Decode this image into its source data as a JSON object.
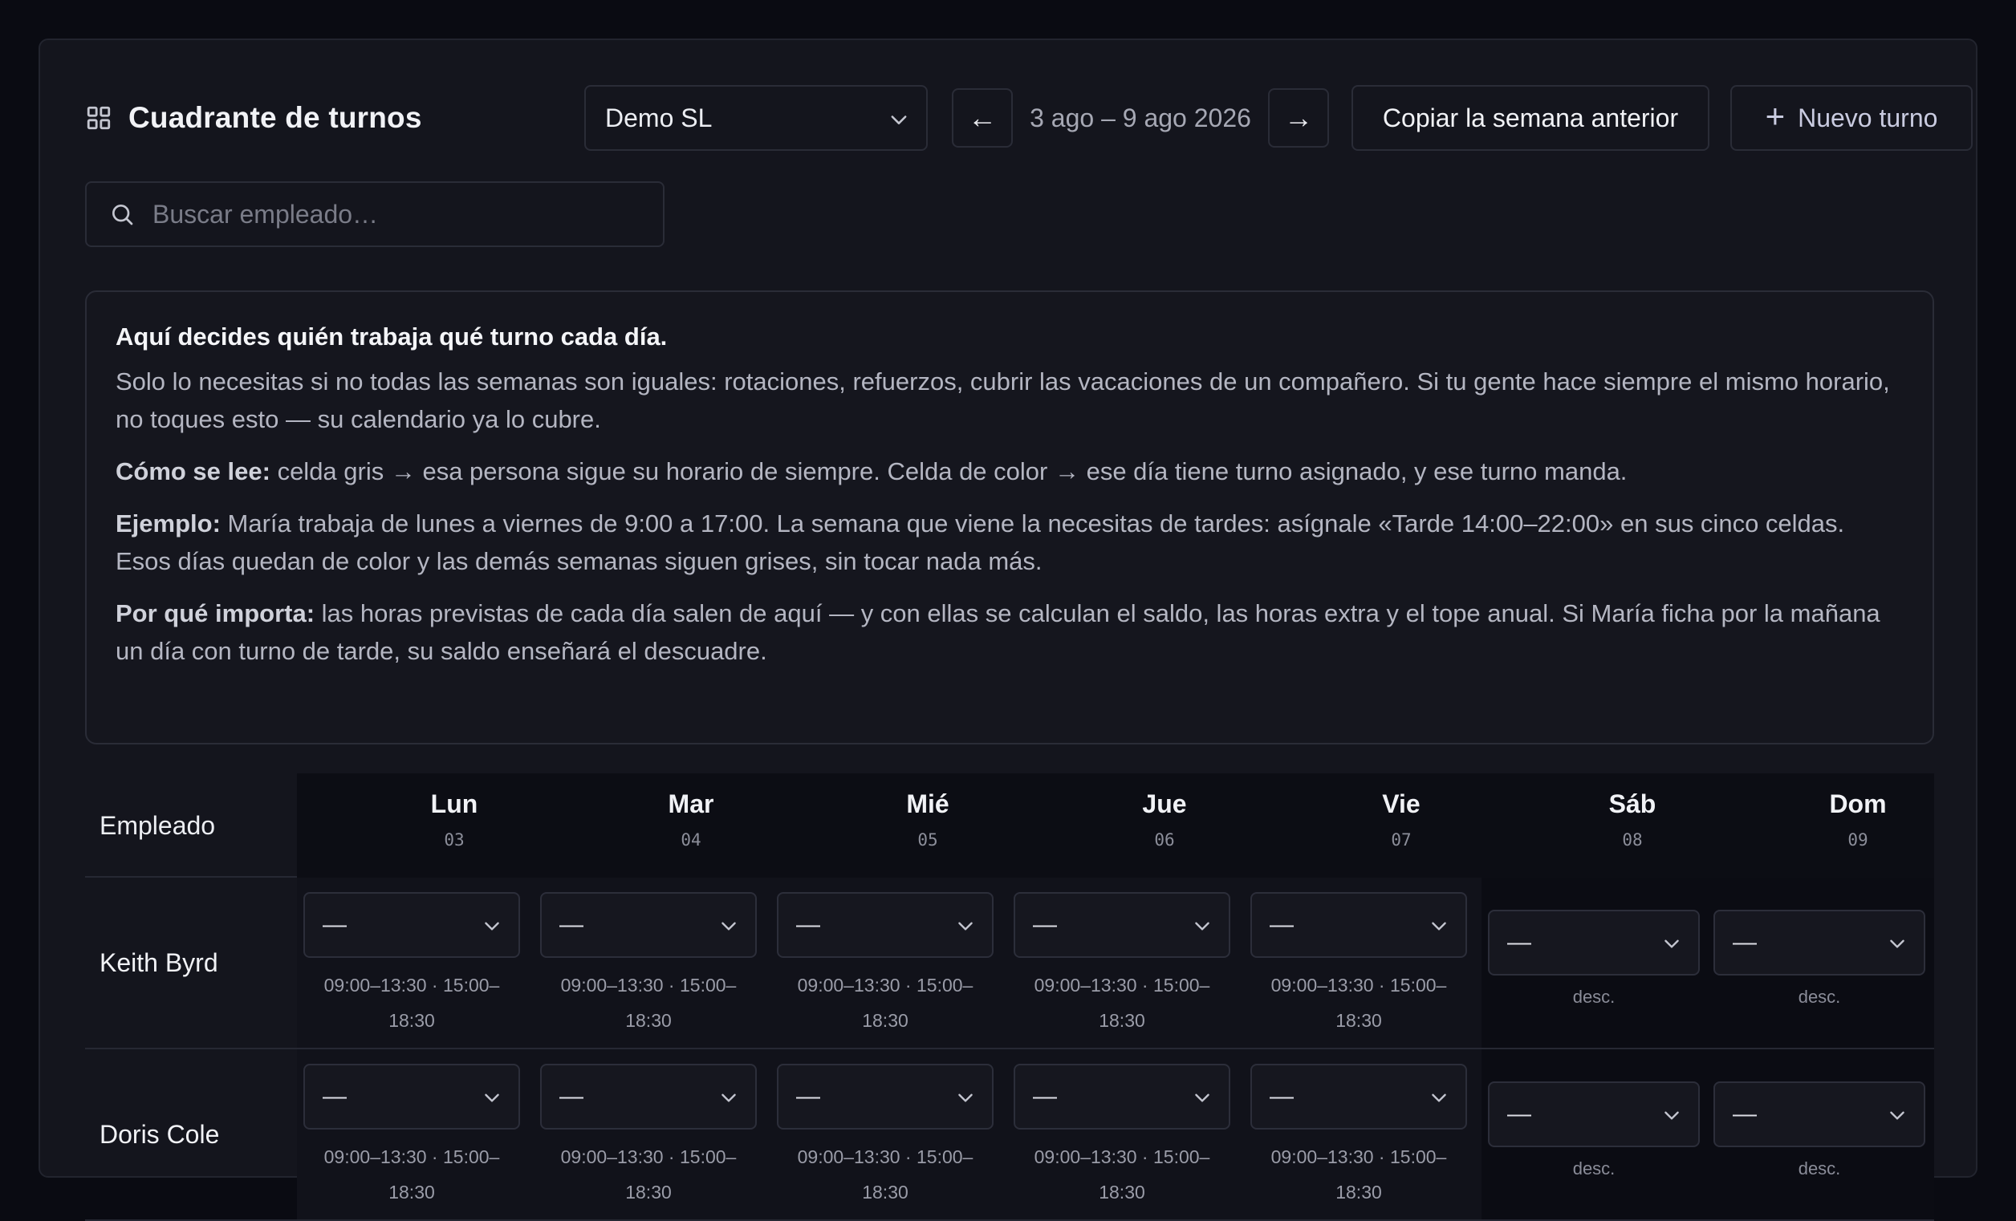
{
  "header": {
    "title": "Cuadrante de turnos",
    "company": "Demo SL",
    "prev_label": "←",
    "next_label": "→",
    "week_range": "3 ago – 9 ago 2026",
    "copy_week_label": "Copiar la semana anterior",
    "new_shift_label": "Nuevo turno"
  },
  "search": {
    "placeholder": "Buscar empleado…"
  },
  "info": {
    "heading": "Aquí decides quién trabaja qué turno cada día.",
    "p1": "Solo lo necesitas si no todas las semanas son iguales: rotaciones, refuerzos, cubrir las vacaciones de un compañero. Si tu gente hace siempre el mismo horario, no toques esto — su calendario ya lo cubre.",
    "p2_label": "Cómo se lee:",
    "p2": " celda gris → esa persona sigue su horario de siempre. Celda de color → ese día tiene turno asignado, y ese turno manda.",
    "p3_label": "Ejemplo:",
    "p3": " María trabaja de lunes a viernes de 9:00 a 17:00. La semana que viene la necesitas de tardes: asígnale «Tarde 14:00–22:00» en sus cinco celdas. Esos días quedan de color y las demás semanas siguen grises, sin tocar nada más.",
    "p4_label": "Por qué importa:",
    "p4": " las horas previstas de cada día salen de aquí — y con ellas se calculan el saldo, las horas extra y el tope anual. Si María ficha por la mañana un día con turno de tarde, su saldo enseñará el descuadre."
  },
  "table": {
    "employee_header": "Empleado",
    "days": [
      {
        "name": "Lun",
        "date": "03"
      },
      {
        "name": "Mar",
        "date": "04"
      },
      {
        "name": "Mié",
        "date": "05"
      },
      {
        "name": "Jue",
        "date": "06"
      },
      {
        "name": "Vie",
        "date": "07"
      },
      {
        "name": "Sáb",
        "date": "08"
      },
      {
        "name": "Dom",
        "date": "09"
      }
    ],
    "select_value": "—",
    "weekday_hours_line1": "09:00–13:30 · 15:00–",
    "weekday_hours_line2": "18:30",
    "weekend_note": "desc.",
    "rows": [
      {
        "employee": "Keith Byrd"
      },
      {
        "employee": "Doris Cole"
      }
    ]
  }
}
